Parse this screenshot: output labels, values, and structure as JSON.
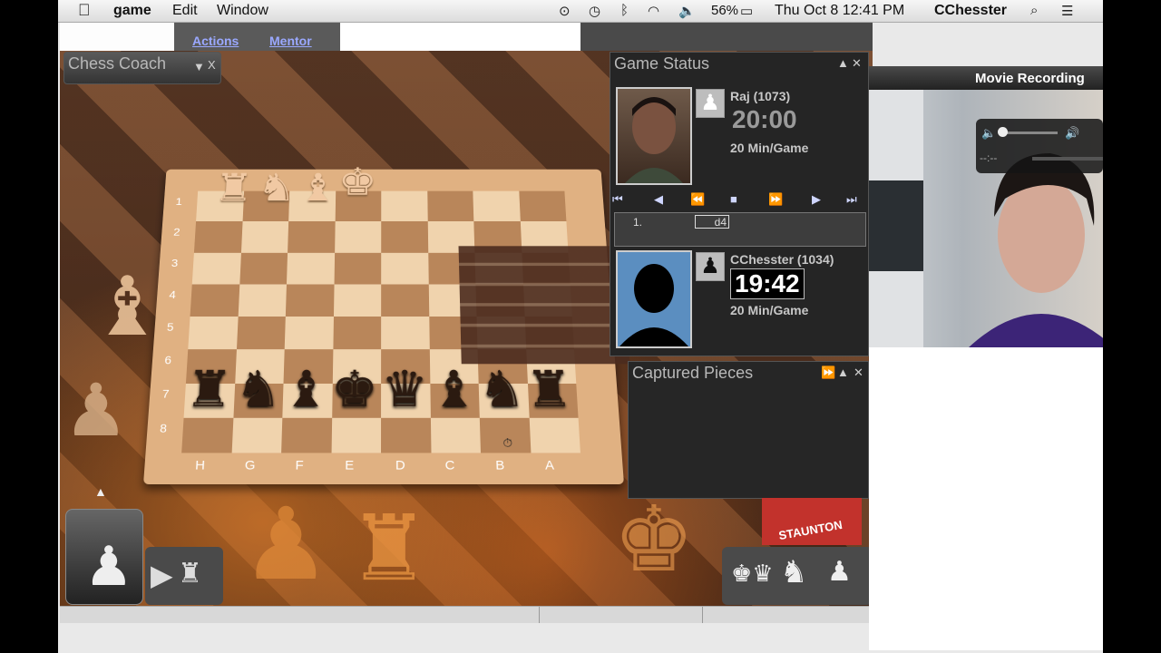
{
  "menubar": {
    "app": "game",
    "items": [
      "Edit",
      "Window"
    ],
    "battery": "56%",
    "datetime": "Thu Oct 8  12:41 PM",
    "user": "CChesster"
  },
  "chess_app": {
    "tabs": [
      "Actions",
      "Mentor"
    ],
    "chess_coach": {
      "title": "Chess Coach",
      "close": "X"
    },
    "board": {
      "ranks": [
        "1",
        "2",
        "3",
        "4",
        "5",
        "6",
        "7",
        "8"
      ],
      "files": [
        "H",
        "G",
        "F",
        "E",
        "D",
        "C",
        "B",
        "A"
      ]
    },
    "game_status": {
      "title": "Game Status",
      "opponent": {
        "name": "Raj (1073)",
        "time": "20:00",
        "type": "20 Min/Game"
      },
      "player": {
        "name": "CChesster (1034)",
        "time": "19:42",
        "type": "20 Min/Game"
      },
      "moves": [
        {
          "num": "1.",
          "white": "",
          "black": "d4"
        }
      ],
      "nav": [
        "⏮",
        "◀",
        "⏪",
        "■",
        "⏩",
        "▶",
        "⏭"
      ]
    },
    "captured_pieces": {
      "title": "Captured Pieces"
    },
    "brand": "STAUNTON",
    "colors": {
      "panel_bg": "#262626",
      "tab_link": "#9aa8ff"
    }
  },
  "movie_recording": {
    "title": "Movie Recording",
    "elapsed": "--:--"
  }
}
